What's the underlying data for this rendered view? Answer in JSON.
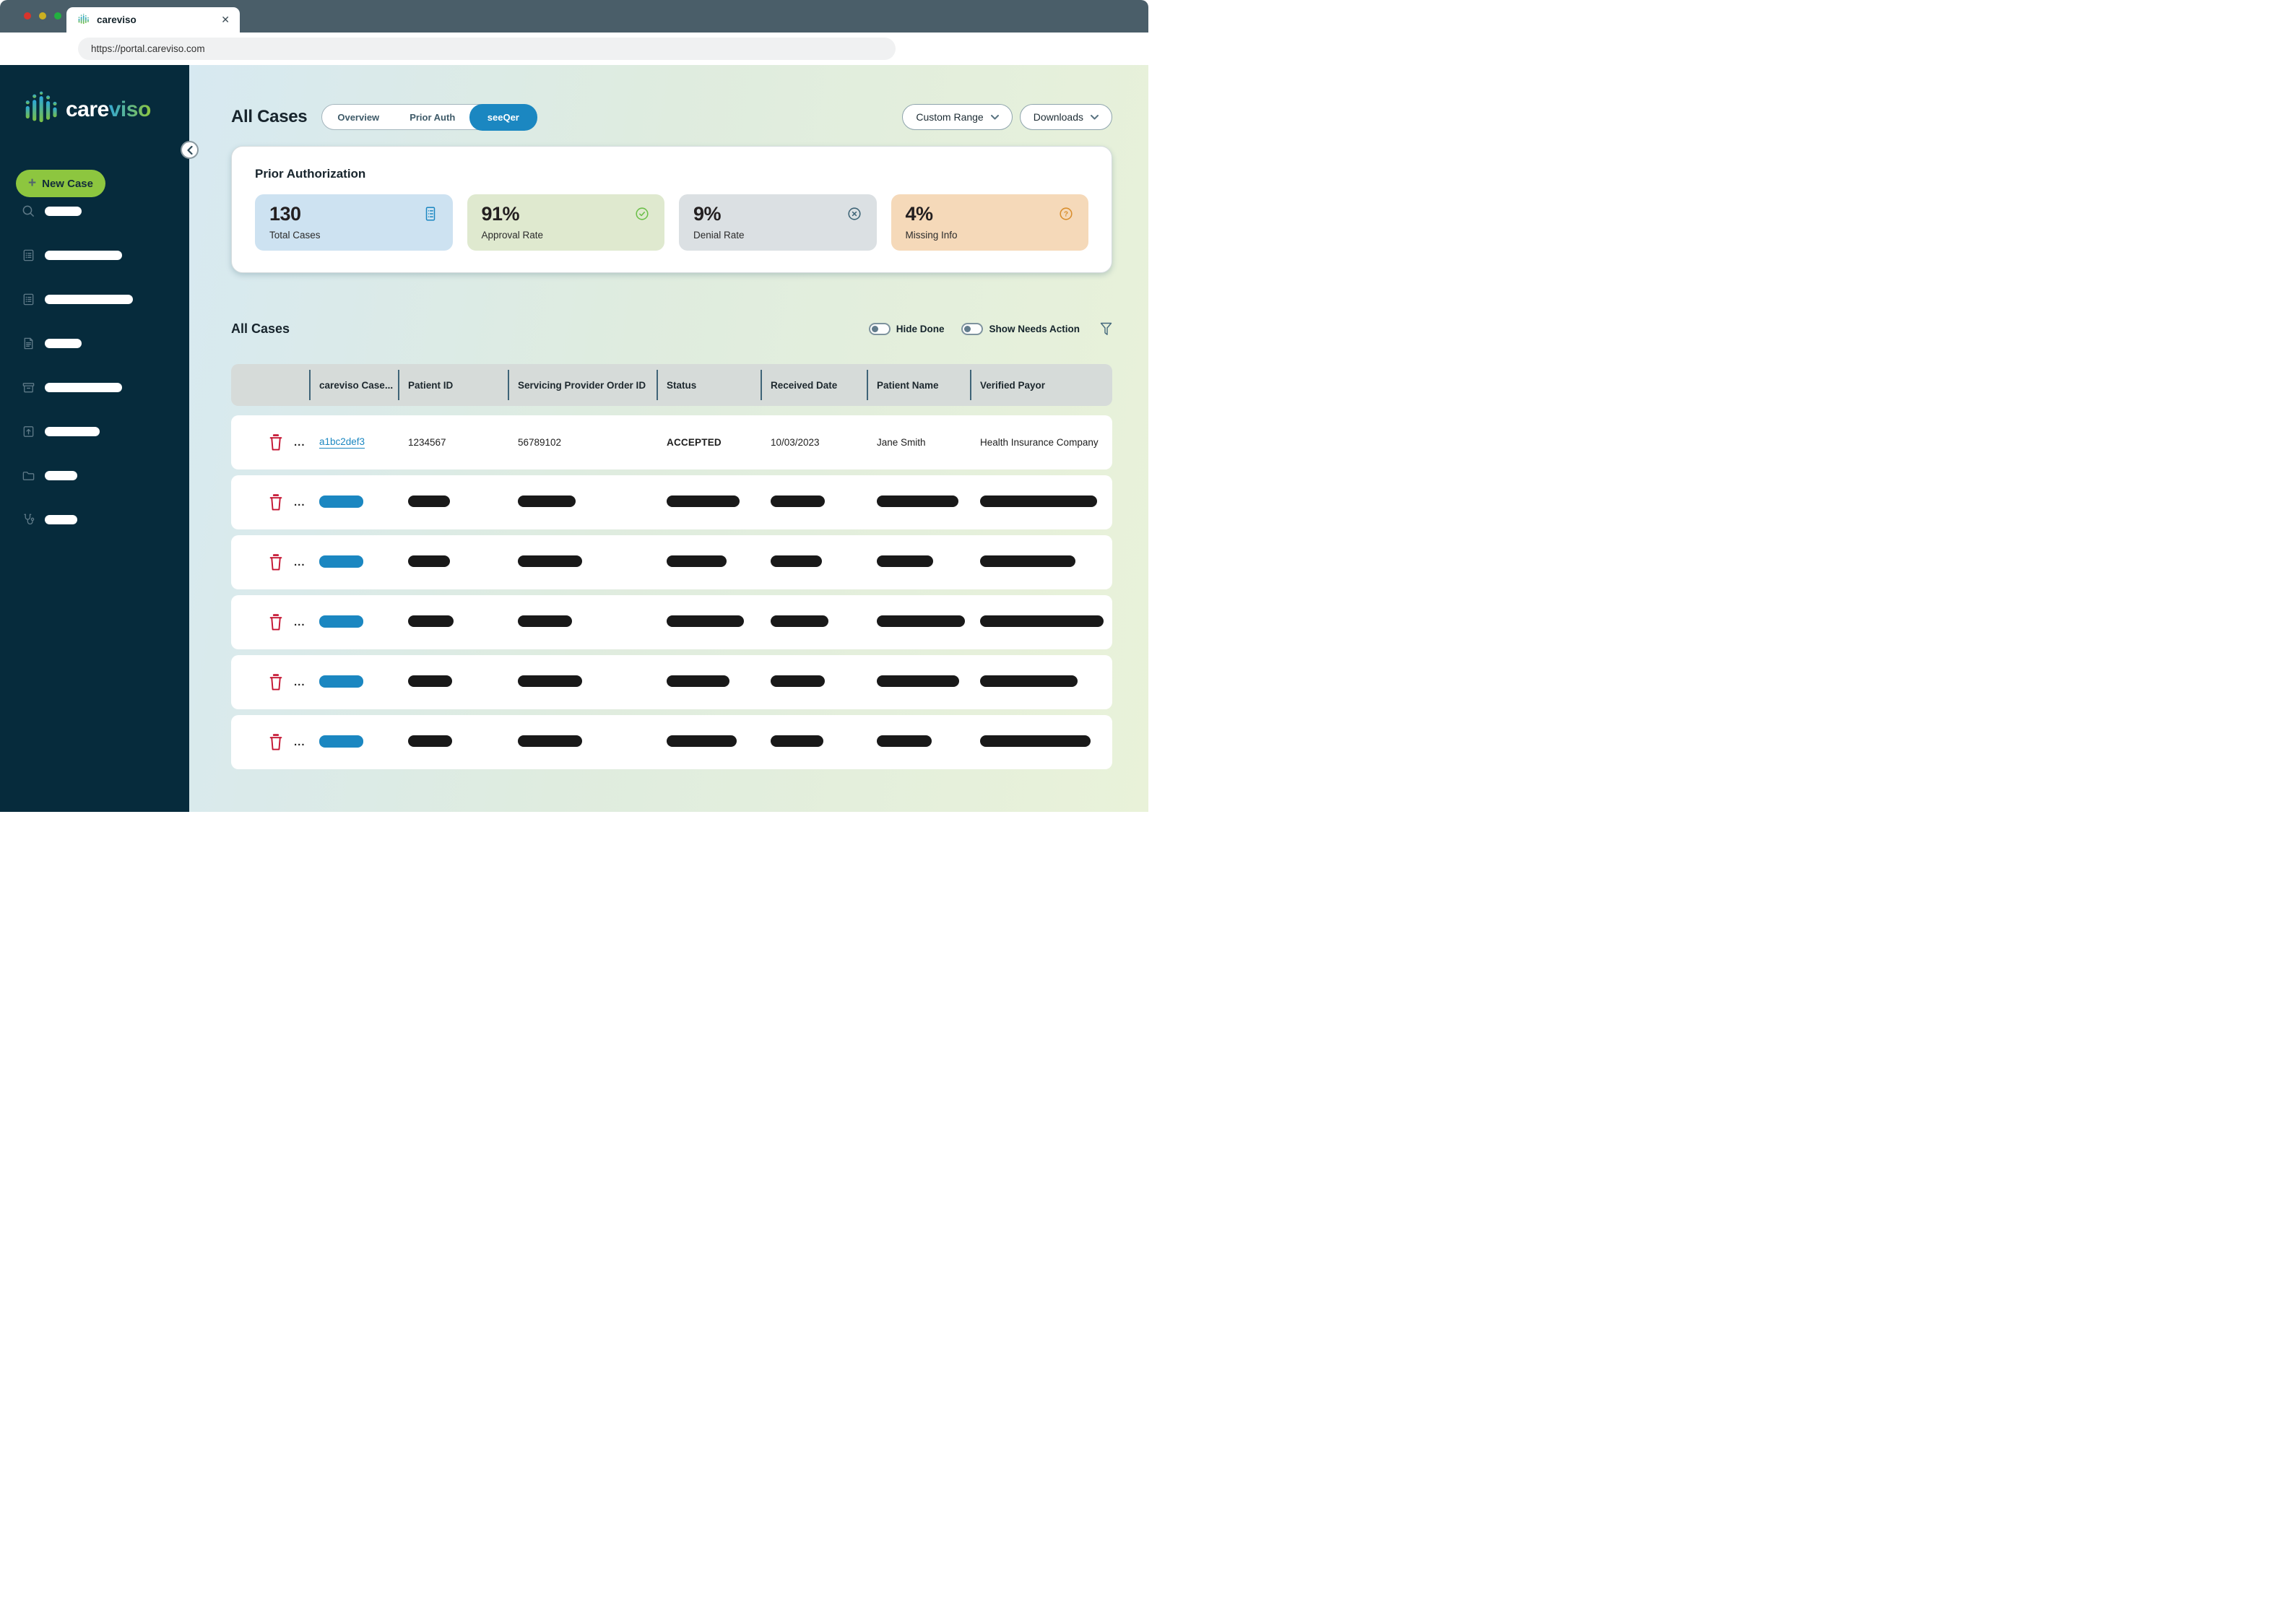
{
  "browser": {
    "tab_title": "careviso",
    "url": "https://portal.careviso.com"
  },
  "icons": {
    "close": "✕",
    "plus": "+",
    "ellipsis": "..."
  },
  "brand": {
    "word_care": "care",
    "word_viso": "viso"
  },
  "sidebar": {
    "new_case_label": "New Case",
    "items": [
      {
        "icon": "search-icon"
      },
      {
        "icon": "clipboard-list-icon"
      },
      {
        "icon": "clipboard-list-icon"
      },
      {
        "icon": "file-text-icon"
      },
      {
        "icon": "archive-box-icon"
      },
      {
        "icon": "file-upload-icon"
      },
      {
        "icon": "folder-icon"
      },
      {
        "icon": "stethoscope-icon"
      }
    ]
  },
  "header": {
    "title": "All Cases",
    "tabs": [
      {
        "label": "Overview",
        "active": false
      },
      {
        "label": "Prior Auth",
        "active": false
      },
      {
        "label": "seeQer",
        "active": true
      }
    ],
    "custom_range_label": "Custom Range",
    "downloads_label": "Downloads"
  },
  "prior_auth": {
    "title": "Prior Authorization",
    "stats": [
      {
        "value": "130",
        "label": "Total Cases",
        "icon": "clipboard-icon",
        "bg": "#cde2f1",
        "icon_color": "#1b87c1"
      },
      {
        "value": "91%",
        "label": "Approval Rate",
        "icon": "check-circle-icon",
        "bg": "#dfe9cf",
        "icon_color": "#6cbf4a"
      },
      {
        "value": "9%",
        "label": "Denial Rate",
        "icon": "x-circle-icon",
        "bg": "#dbe0e3",
        "icon_color": "#3e6476"
      },
      {
        "value": "4%",
        "label": "Missing Info",
        "icon": "question-circle-icon",
        "bg": "#f5d9b9",
        "icon_color": "#d98e2d"
      }
    ]
  },
  "cases": {
    "title": "All Cases",
    "hide_done_label": "Hide Done",
    "show_needs_action_label": "Show Needs Action",
    "columns": [
      "careviso Case...",
      "Patient ID",
      "Servicing Provider Order ID",
      "Status",
      "Received Date",
      "Patient Name",
      "Verified Payor"
    ],
    "rows": [
      {
        "case_id": "a1bc2def3",
        "patient_id": "1234567",
        "order_id": "56789102",
        "status": "ACCEPTED",
        "received_date": "10/03/2023",
        "patient_name": "Jane Smith",
        "verified_payor": "Health Insurance Company"
      }
    ],
    "redacted_row_count": 5
  },
  "colors": {
    "accent_blue": "#1b87c1",
    "new_case_green": "#8dc63f",
    "trash_red": "#c41230",
    "sidebar_bg": "#062b3c",
    "titlebar_bg": "#4a5e69"
  }
}
